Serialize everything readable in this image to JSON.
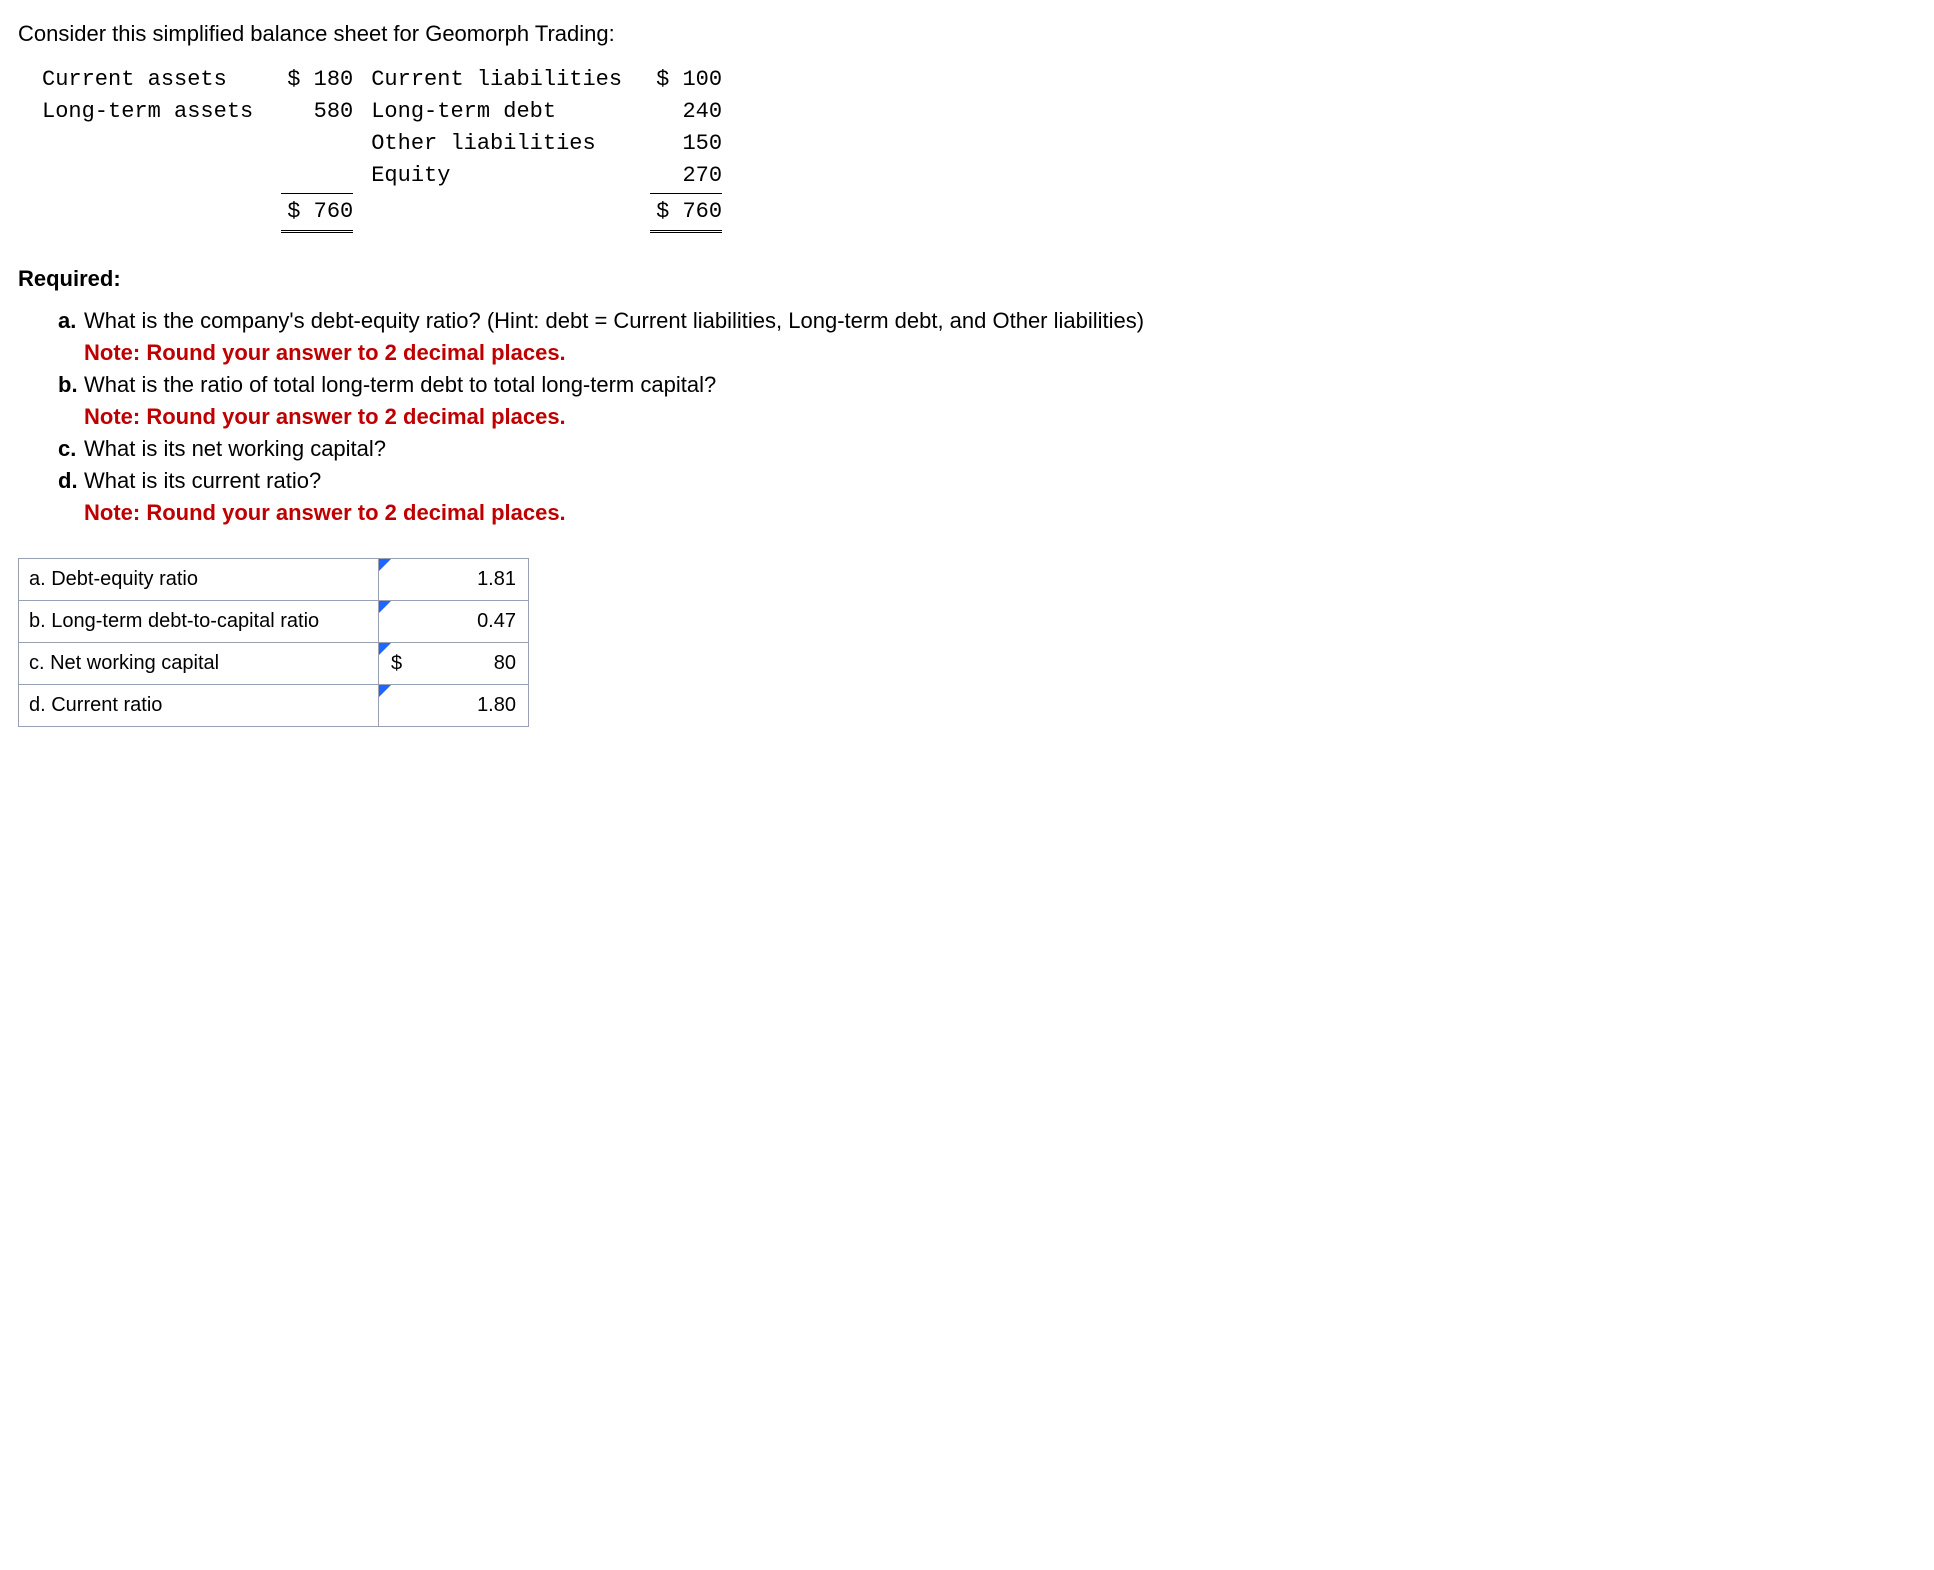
{
  "intro": "Consider this simplified balance sheet for Geomorph Trading:",
  "balance_sheet": {
    "left": [
      {
        "label": "Current assets",
        "prefix": "$",
        "value": "180"
      },
      {
        "label": "Long-term assets",
        "prefix": "",
        "value": "580"
      }
    ],
    "left_total": {
      "prefix": "$",
      "value": "760"
    },
    "right": [
      {
        "label": "Current liabilities",
        "prefix": "$",
        "value": "100"
      },
      {
        "label": "Long-term debt",
        "prefix": "",
        "value": "240"
      },
      {
        "label": "Other liabilities",
        "prefix": "",
        "value": "150"
      },
      {
        "label": "Equity",
        "prefix": "",
        "value": "270"
      }
    ],
    "right_total": {
      "prefix": "$",
      "value": "760"
    }
  },
  "required_heading": "Required:",
  "requirements": {
    "a": {
      "marker": "a.",
      "text": "What is the company's debt-equity ratio? (Hint: debt = Current liabilities, Long-term debt, and Other liabilities)",
      "note": "Note: Round your answer to 2 decimal places."
    },
    "b": {
      "marker": "b.",
      "text": "What is the ratio of total long-term debt to total long-term capital?",
      "note": "Note: Round your answer to 2 decimal places."
    },
    "c": {
      "marker": "c.",
      "text": "What is its net working capital?"
    },
    "d": {
      "marker": "d.",
      "text": "What is its current ratio?",
      "note": "Note: Round your answer to 2 decimal places."
    }
  },
  "answers": {
    "a": {
      "label": "a. Debt-equity ratio",
      "prefix": "",
      "value": "1.81"
    },
    "b": {
      "label": "b. Long-term debt-to-capital ratio",
      "prefix": "",
      "value": "0.47"
    },
    "c": {
      "label": "c. Net working capital",
      "prefix": "$",
      "value": "80"
    },
    "d": {
      "label": "d. Current ratio",
      "prefix": "",
      "value": "1.80"
    }
  }
}
